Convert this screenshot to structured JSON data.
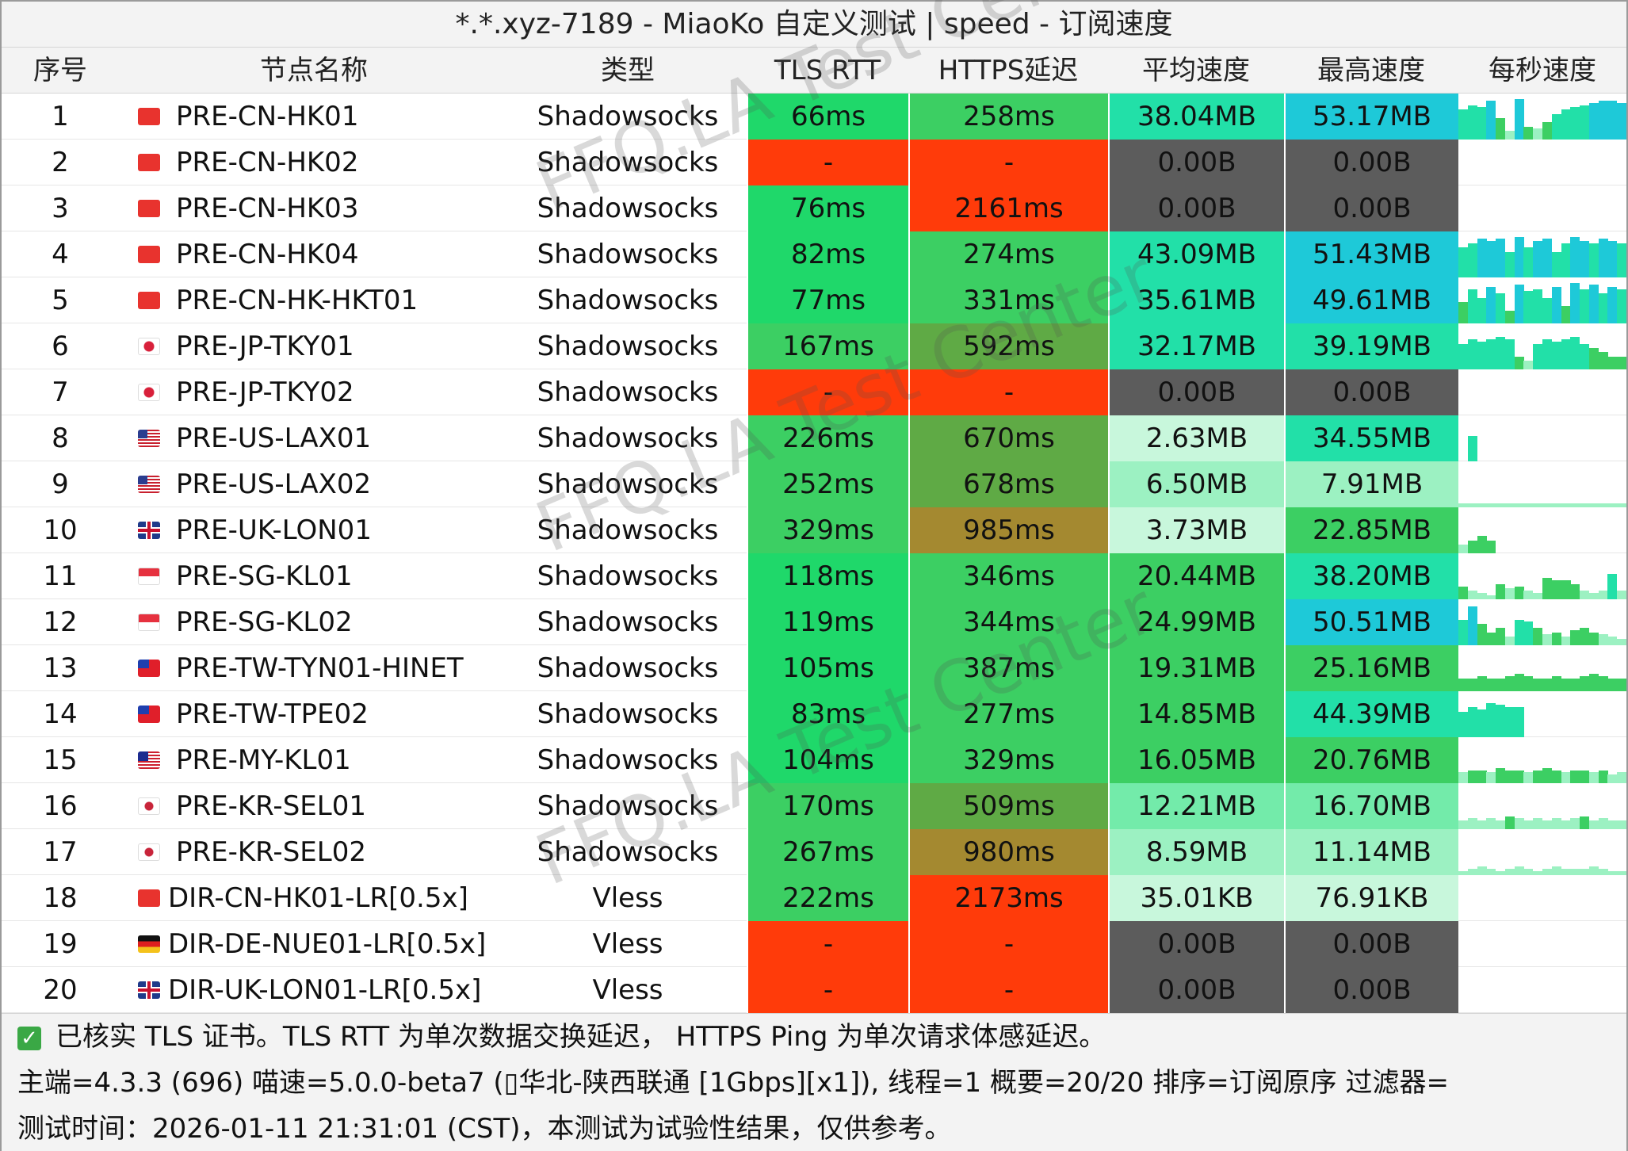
{
  "title": "*.*.xyz-7189 - MiaoKo 自定义测试 | speed - 订阅速度",
  "columns": [
    "序号",
    "节点名称",
    "类型",
    "TLS RTT",
    "HTTPS延迟",
    "平均速度",
    "最高速度",
    "每秒速度"
  ],
  "watermark": "FFQ.LA Test Center",
  "colors": {
    "fail_red": "#ff3b0a",
    "zero_gray": "#5c5c5c",
    "green_bright": "#1fd86a",
    "green_mid": "#3ccf63",
    "green_olive": "#5faa45",
    "brown": "#a48930",
    "cyan": "#1ec9d8",
    "teal": "#22e0a8",
    "mint_pale": "#c8f7dc",
    "mint_light": "#9cf1c2",
    "mint": "#73ebaa"
  },
  "rows": [
    {
      "idx": "1",
      "flag": "hk-flag-icon",
      "name": "PRE-CN-HK01",
      "type": "Shadowsocks",
      "tls": "66ms",
      "https": "258ms",
      "avg": "38.04MB",
      "max": "53.17MB",
      "tls_color": "#1fd86a",
      "https_color": "#3ccf63",
      "avg_color": "#22e0a8",
      "max_color": "#1ec9d8",
      "spark": [
        0.7,
        0.8,
        0.75,
        0.9,
        0.5,
        0.2,
        0.95,
        0.3,
        0.25,
        0.4,
        0.6,
        0.7,
        0.75,
        0.8,
        0.85,
        0.9,
        0.9,
        0.85
      ]
    },
    {
      "idx": "2",
      "flag": "hk-flag-icon",
      "name": "PRE-CN-HK02",
      "type": "Shadowsocks",
      "tls": "-",
      "https": "-",
      "avg": "0.00B",
      "max": "0.00B",
      "tls_color": "#ff3b0a",
      "https_color": "#ff3b0a",
      "avg_color": "#5c5c5c",
      "max_color": "#5c5c5c",
      "spark": []
    },
    {
      "idx": "3",
      "flag": "hk-flag-icon",
      "name": "PRE-CN-HK03",
      "type": "Shadowsocks",
      "tls": "76ms",
      "https": "2161ms",
      "avg": "0.00B",
      "max": "0.00B",
      "tls_color": "#1fd86a",
      "https_color": "#ff3b0a",
      "avg_color": "#5c5c5c",
      "max_color": "#5c5c5c",
      "spark": []
    },
    {
      "idx": "4",
      "flag": "hk-flag-icon",
      "name": "PRE-CN-HK04",
      "type": "Shadowsocks",
      "tls": "82ms",
      "https": "274ms",
      "avg": "43.09MB",
      "max": "51.43MB",
      "tls_color": "#1fd86a",
      "https_color": "#3ccf63",
      "avg_color": "#22e0a8",
      "max_color": "#1ec9d8",
      "spark": [
        0.7,
        0.8,
        0.9,
        0.85,
        0.9,
        0.6,
        0.95,
        0.7,
        0.85,
        0.9,
        0.6,
        0.8,
        0.95,
        0.85,
        0.8,
        0.9,
        0.85,
        0.8
      ]
    },
    {
      "idx": "5",
      "flag": "hk-flag-icon",
      "name": "PRE-CN-HK-HKT01",
      "type": "Shadowsocks",
      "tls": "77ms",
      "https": "331ms",
      "avg": "35.61MB",
      "max": "49.61MB",
      "tls_color": "#1fd86a",
      "https_color": "#3ccf63",
      "avg_color": "#22e0a8",
      "max_color": "#1ec9d8",
      "spark": [
        0.5,
        0.8,
        0.6,
        0.85,
        0.7,
        0.3,
        0.9,
        0.75,
        0.8,
        0.6,
        0.85,
        0.4,
        0.95,
        0.8,
        0.9,
        0.7,
        0.85,
        0.8
      ]
    },
    {
      "idx": "6",
      "flag": "jp-flag-icon",
      "name": "PRE-JP-TKY01",
      "type": "Shadowsocks",
      "tls": "167ms",
      "https": "592ms",
      "avg": "32.17MB",
      "max": "39.19MB",
      "tls_color": "#3ccf63",
      "https_color": "#5faa45",
      "avg_color": "#22e0a8",
      "max_color": "#22e0a8",
      "spark": [
        0.6,
        0.7,
        0.65,
        0.7,
        0.75,
        0.7,
        0.3,
        0.2,
        0.6,
        0.7,
        0.65,
        0.7,
        0.75,
        0.6,
        0.5,
        0.4,
        0.3,
        0.3
      ]
    },
    {
      "idx": "7",
      "flag": "jp-flag-icon",
      "name": "PRE-JP-TKY02",
      "type": "Shadowsocks",
      "tls": "-",
      "https": "-",
      "avg": "0.00B",
      "max": "0.00B",
      "tls_color": "#ff3b0a",
      "https_color": "#ff3b0a",
      "avg_color": "#5c5c5c",
      "max_color": "#5c5c5c",
      "spark": []
    },
    {
      "idx": "8",
      "flag": "us-flag-icon",
      "name": "PRE-US-LAX01",
      "type": "Shadowsocks",
      "tls": "226ms",
      "https": "670ms",
      "avg": "2.63MB",
      "max": "34.55MB",
      "tls_color": "#3ccf63",
      "https_color": "#5faa45",
      "avg_color": "#c8f7dc",
      "max_color": "#22e0a8",
      "spark": [
        0,
        0.6,
        0,
        0,
        0,
        0,
        0,
        0,
        0,
        0,
        0,
        0,
        0,
        0,
        0,
        0,
        0,
        0
      ]
    },
    {
      "idx": "9",
      "flag": "us-flag-icon",
      "name": "PRE-US-LAX02",
      "type": "Shadowsocks",
      "tls": "252ms",
      "https": "678ms",
      "avg": "6.50MB",
      "max": "7.91MB",
      "tls_color": "#3ccf63",
      "https_color": "#5faa45",
      "avg_color": "#9cf1c2",
      "max_color": "#9cf1c2",
      "spark": [
        0.1,
        0.1,
        0.1,
        0.1,
        0.1,
        0.1,
        0.1,
        0.1,
        0.1,
        0.1,
        0.1,
        0.1,
        0.1,
        0.1,
        0.1,
        0.1,
        0.1,
        0.1
      ]
    },
    {
      "idx": "10",
      "flag": "uk-flag-icon",
      "name": "PRE-UK-LON01",
      "type": "Shadowsocks",
      "tls": "329ms",
      "https": "985ms",
      "avg": "3.73MB",
      "max": "22.85MB",
      "tls_color": "#3ccf63",
      "https_color": "#a48930",
      "avg_color": "#c8f7dc",
      "max_color": "#3ccf63",
      "spark": [
        0.2,
        0.3,
        0.4,
        0.3,
        0,
        0,
        0,
        0,
        0,
        0,
        0,
        0,
        0,
        0,
        0,
        0,
        0,
        0
      ]
    },
    {
      "idx": "11",
      "flag": "sg-flag-icon",
      "name": "PRE-SG-KL01",
      "type": "Shadowsocks",
      "tls": "118ms",
      "https": "346ms",
      "avg": "20.44MB",
      "max": "38.20MB",
      "tls_color": "#1fd86a",
      "https_color": "#3ccf63",
      "avg_color": "#3ccf63",
      "max_color": "#22e0a8",
      "spark": [
        0.3,
        0.2,
        0.15,
        0.1,
        0.35,
        0.25,
        0.3,
        0.2,
        0.15,
        0.5,
        0.45,
        0.45,
        0.35,
        0.2,
        0.15,
        0.2,
        0.6,
        0.2
      ]
    },
    {
      "idx": "12",
      "flag": "sg-flag-icon",
      "name": "PRE-SG-KL02",
      "type": "Shadowsocks",
      "tls": "119ms",
      "https": "344ms",
      "avg": "24.99MB",
      "max": "50.51MB",
      "tls_color": "#1fd86a",
      "https_color": "#3ccf63",
      "avg_color": "#3ccf63",
      "max_color": "#1ec9d8",
      "spark": [
        0.6,
        0.9,
        0.5,
        0.3,
        0.4,
        0.2,
        0.6,
        0.55,
        0.4,
        0.25,
        0.3,
        0.2,
        0.35,
        0.4,
        0.3,
        0.25,
        0.2,
        0.15
      ]
    },
    {
      "idx": "13",
      "flag": "tw-flag-icon",
      "name": "PRE-TW-TYN01-HINET",
      "type": "Shadowsocks",
      "tls": "105ms",
      "https": "387ms",
      "avg": "19.31MB",
      "max": "25.16MB",
      "tls_color": "#1fd86a",
      "https_color": "#3ccf63",
      "avg_color": "#3ccf63",
      "max_color": "#3ccf63",
      "spark": [
        0.3,
        0.3,
        0.35,
        0.3,
        0.3,
        0.35,
        0.4,
        0.35,
        0.3,
        0.3,
        0.35,
        0.3,
        0.3,
        0.35,
        0.4,
        0.35,
        0.3,
        0.3
      ]
    },
    {
      "idx": "14",
      "flag": "tw-flag-icon",
      "name": "PRE-TW-TPE02",
      "type": "Shadowsocks",
      "tls": "83ms",
      "https": "277ms",
      "avg": "14.85MB",
      "max": "44.39MB",
      "tls_color": "#1fd86a",
      "https_color": "#3ccf63",
      "avg_color": "#3ccf63",
      "max_color": "#22e0a8",
      "spark": [
        0.6,
        0.7,
        0.65,
        0.8,
        0.75,
        0.7,
        0.7,
        0,
        0,
        0,
        0,
        0,
        0,
        0,
        0,
        0,
        0,
        0
      ]
    },
    {
      "idx": "15",
      "flag": "my-flag-icon",
      "name": "PRE-MY-KL01",
      "type": "Shadowsocks",
      "tls": "104ms",
      "https": "329ms",
      "avg": "16.05MB",
      "max": "20.76MB",
      "tls_color": "#1fd86a",
      "https_color": "#3ccf63",
      "avg_color": "#3ccf63",
      "max_color": "#3ccf63",
      "spark": [
        0.25,
        0.3,
        0.3,
        0.25,
        0.35,
        0.3,
        0.3,
        0.25,
        0.3,
        0.35,
        0.3,
        0.25,
        0.3,
        0.3,
        0.25,
        0.3,
        0.2,
        0.25
      ]
    },
    {
      "idx": "16",
      "flag": "kr-flag-icon",
      "name": "PRE-KR-SEL01",
      "type": "Shadowsocks",
      "tls": "170ms",
      "https": "509ms",
      "avg": "12.21MB",
      "max": "16.70MB",
      "tls_color": "#3ccf63",
      "https_color": "#5faa45",
      "avg_color": "#73ebaa",
      "max_color": "#73ebaa",
      "spark": [
        0.2,
        0.25,
        0.2,
        0.25,
        0.2,
        0.3,
        0.25,
        0.2,
        0.25,
        0.2,
        0.25,
        0.2,
        0.25,
        0.3,
        0.2,
        0.25,
        0.2,
        0.2
      ]
    },
    {
      "idx": "17",
      "flag": "kr-flag-icon",
      "name": "PRE-KR-SEL02",
      "type": "Shadowsocks",
      "tls": "267ms",
      "https": "980ms",
      "avg": "8.59MB",
      "max": "11.14MB",
      "tls_color": "#3ccf63",
      "https_color": "#a48930",
      "avg_color": "#9cf1c2",
      "max_color": "#9cf1c2",
      "spark": [
        0.1,
        0.15,
        0.2,
        0.15,
        0.1,
        0.15,
        0.2,
        0.15,
        0.1,
        0.15,
        0.2,
        0.15,
        0.15,
        0.15,
        0.2,
        0.15,
        0.1,
        0.1
      ]
    },
    {
      "idx": "18",
      "flag": "hk-flag-icon",
      "name": "DIR-CN-HK01-LR[0.5x]",
      "type": "Vless",
      "tls": "222ms",
      "https": "2173ms",
      "avg": "35.01KB",
      "max": "76.91KB",
      "tls_color": "#3ccf63",
      "https_color": "#ff3b0a",
      "avg_color": "#c8f7dc",
      "max_color": "#c8f7dc",
      "spark": []
    },
    {
      "idx": "19",
      "flag": "de-flag-icon",
      "name": "DIR-DE-NUE01-LR[0.5x]",
      "type": "Vless",
      "tls": "-",
      "https": "-",
      "avg": "0.00B",
      "max": "0.00B",
      "tls_color": "#ff3b0a",
      "https_color": "#ff3b0a",
      "avg_color": "#5c5c5c",
      "max_color": "#5c5c5c",
      "spark": []
    },
    {
      "idx": "20",
      "flag": "uk-flag-icon",
      "name": "DIR-UK-LON01-LR[0.5x]",
      "type": "Vless",
      "tls": "-",
      "https": "-",
      "avg": "0.00B",
      "max": "0.00B",
      "tls_color": "#ff3b0a",
      "https_color": "#ff3b0a",
      "avg_color": "#5c5c5c",
      "max_color": "#5c5c5c",
      "spark": []
    }
  ],
  "footer": {
    "line1": "已核实 TLS 证书。TLS RTT 为单次数据交换延迟，  HTTPS Ping 为单次请求体感延迟。",
    "line2": "主端=4.3.3 (696) 喵速=5.0.0-beta7 (▯华北-陕西联通 [1Gbps][x1]), 线程=1 概要=20/20 排序=订阅原序 过滤器=",
    "line3": "测试时间：2026-01-11 21:31:01 (CST)，本测试为试验性结果，仅供参考。"
  }
}
